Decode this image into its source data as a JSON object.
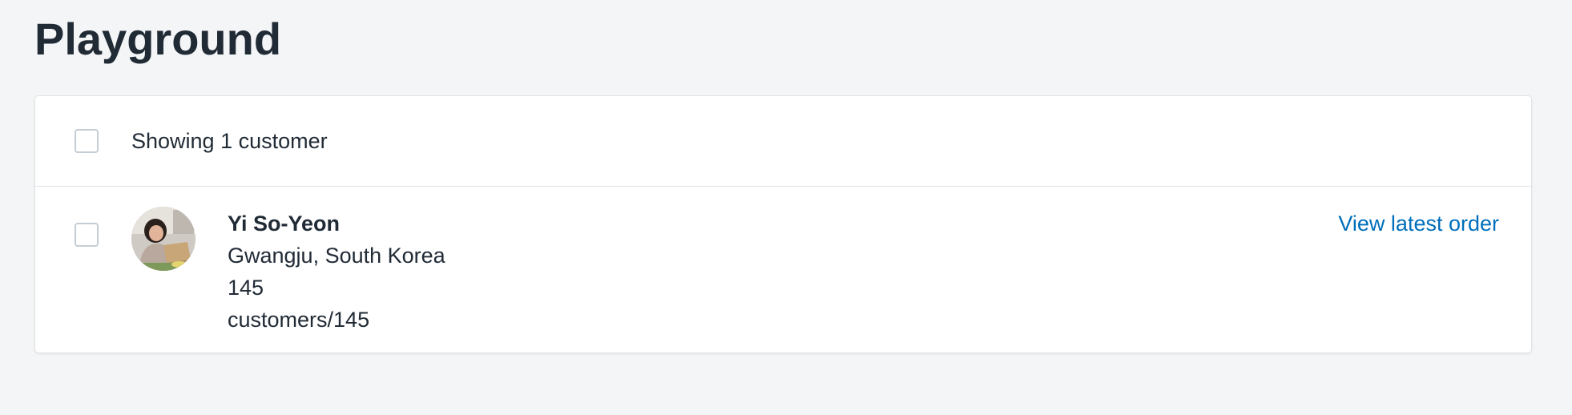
{
  "page": {
    "title": "Playground"
  },
  "list": {
    "header_text": "Showing 1 customer",
    "select_all_checked": false
  },
  "customers": [
    {
      "name": "Yi So-Yeon",
      "location": "Gwangju, South Korea",
      "id": "145",
      "url": "customers/145",
      "action_label": "View latest order",
      "checked": false
    }
  ],
  "colors": {
    "background": "#f4f5f7",
    "text": "#212b36",
    "link": "#006fbb",
    "border": "#dfe3e8"
  },
  "icons": {
    "avatar": "customer-photo"
  }
}
